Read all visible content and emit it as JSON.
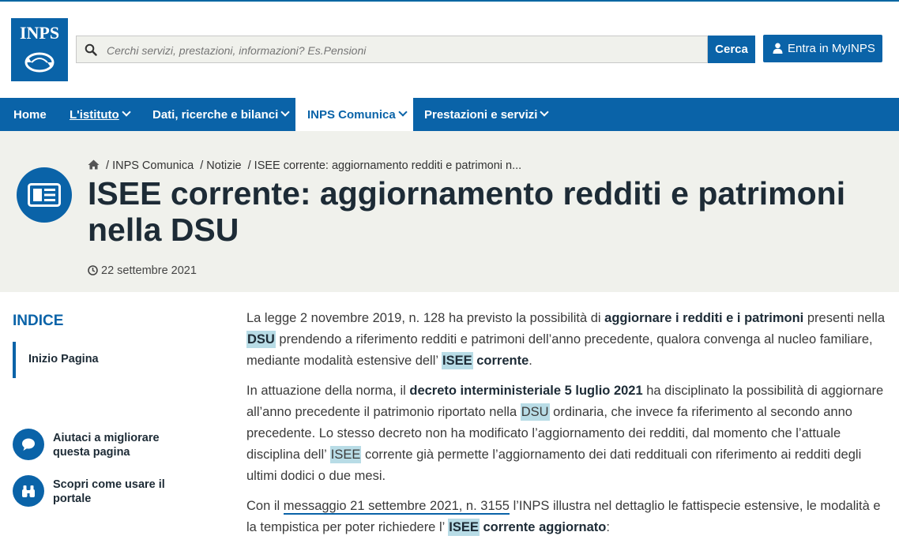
{
  "logo": {
    "text": "INPS"
  },
  "search": {
    "placeholder": "Cerchi servizi, prestazioni, informazioni? Es.Pensioni",
    "button_label": "Cerca"
  },
  "login_button": "Entra in MyINPS",
  "nav": {
    "items": [
      {
        "label": "Home"
      },
      {
        "label": "L'istituto"
      },
      {
        "label": "Dati, ricerche e bilanci"
      },
      {
        "label": "INPS Comunica"
      },
      {
        "label": "Prestazioni e servizi"
      }
    ]
  },
  "breadcrumb": {
    "sep": "/",
    "items": [
      "INPS Comunica",
      "Notizie",
      "ISEE corrente: aggiornamento redditi e patrimoni n..."
    ]
  },
  "page_title": "ISEE corrente: aggiornamento redditi e patrimoni nella DSU",
  "date": "22 settembre 2021",
  "sidebar": {
    "indice_title": "INDICE",
    "toc_item": "Inizio Pagina",
    "feedback": "Aiutaci a migliorare questa pagina",
    "guide": "Scopri come usare il portale"
  },
  "article": {
    "p1": [
      "La legge 2 novembre 2019, n. 128 ha previsto la possibilità di ",
      "aggiornare i redditi e i patrimoni",
      " presenti nella ",
      "DSU",
      " prendendo a riferimento redditi e patrimoni dell’anno precedente, qualora convenga al nucleo familiare, mediante modalità estensive dell’ ",
      "ISEE",
      " corrente",
      "."
    ],
    "p2": [
      "In attuazione della norma, il ",
      "decreto interministeriale 5 luglio 2021",
      " ha disciplinato la possibilità di aggiornare all’anno precedente il patrimonio riportato nella ",
      "DSU",
      " ordinaria, che invece fa riferimento al secondo anno precedente. Lo stesso decreto non ha modificato l’aggiornamento dei redditi, dal momento che l’attuale disciplina dell’ ",
      "ISEE",
      " corrente già permette l’aggiornamento dei dati reddituali con riferimento ai redditi degli ultimi dodici o due mesi."
    ],
    "p3": [
      "Con il ",
      "messaggio 21 settembre 2021, n. 3155",
      " l’INPS illustra nel dettaglio le fattispecie estensive, le modalità e la tempistica per poter richiedere l’ ",
      "ISEE",
      " corrente aggiornato",
      ":"
    ]
  }
}
